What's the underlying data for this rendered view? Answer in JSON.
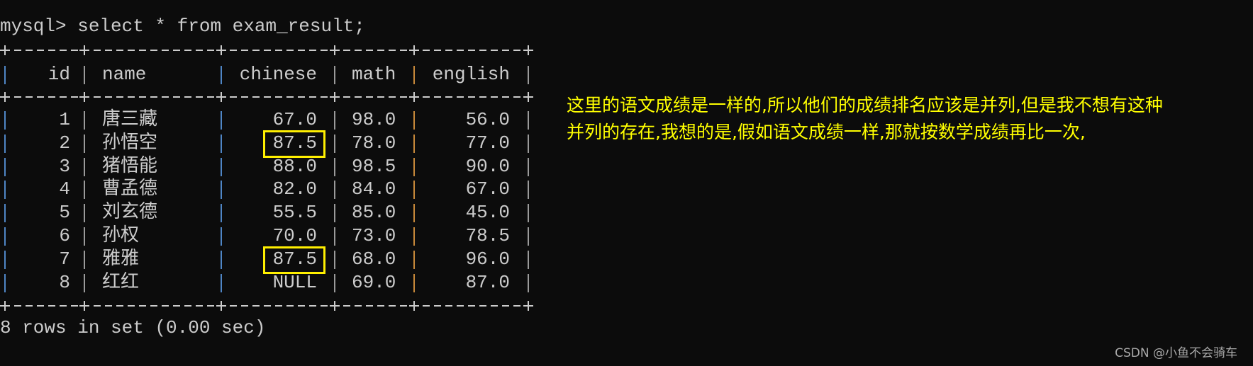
{
  "terminal": {
    "prompt": "mysql> select * from exam_result;",
    "columns": [
      "id",
      "name",
      "chinese",
      "math",
      "english"
    ],
    "rows": [
      [
        "1",
        "唐三藏",
        "67.0",
        "98.0",
        "56.0"
      ],
      [
        "2",
        "孙悟空",
        "87.5",
        "78.0",
        "77.0"
      ],
      [
        "3",
        "猪悟能",
        "88.0",
        "98.5",
        "90.0"
      ],
      [
        "4",
        "曹孟德",
        "82.0",
        "84.0",
        "67.0"
      ],
      [
        "5",
        "刘玄德",
        "55.5",
        "85.0",
        "45.0"
      ],
      [
        "6",
        "孙权",
        "70.0",
        "73.0",
        "78.5"
      ],
      [
        "7",
        "雅雅",
        "87.5",
        "68.0",
        "96.0"
      ],
      [
        "8",
        "红红",
        "NULL",
        "69.0",
        "87.0"
      ]
    ],
    "footer": "8 rows in set (0.00 sec)",
    "highlighted_cells": [
      {
        "row": 2,
        "column": "chinese"
      },
      {
        "row": 7,
        "column": "chinese"
      }
    ],
    "highlight_color": "#ffef00"
  },
  "annotation": {
    "line1": "这里的语文成绩是一样的,所以他们的成绩排名应该是并列,但是我不想有这种",
    "line2": "并列的存在,我想的是,假如语文成绩一样,那就按数学成绩再比一次,",
    "color": "#ffff00"
  },
  "watermark": "CSDN @小鱼不会骑车"
}
